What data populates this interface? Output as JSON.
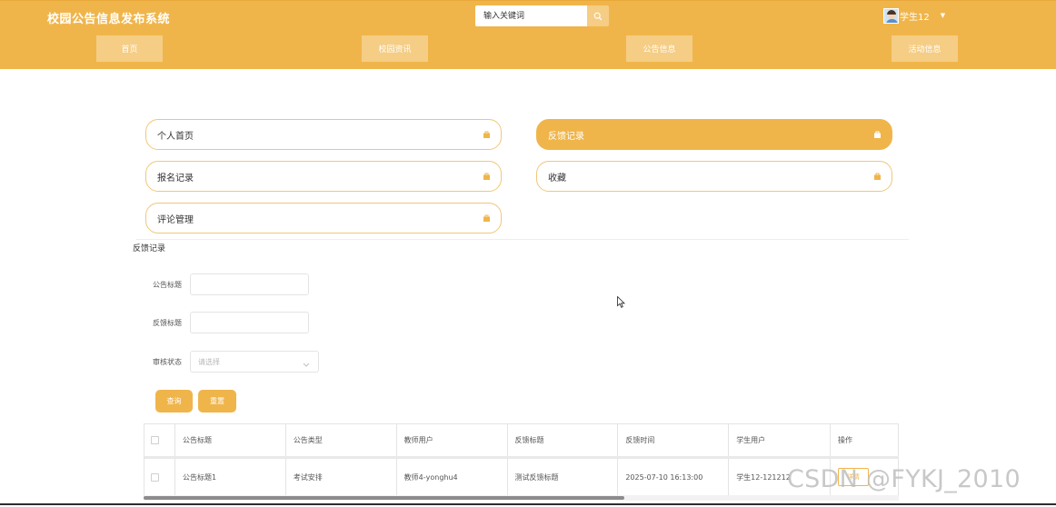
{
  "header": {
    "site_title": "校园公告信息发布系统",
    "search_placeholder": "输入关键词",
    "username": "学生12",
    "nav": [
      "首页",
      "校园资讯",
      "公告信息",
      "活动信息"
    ]
  },
  "menu": {
    "items": [
      "个人首页",
      "反馈记录",
      "报名记录",
      "收藏",
      "评论管理"
    ],
    "active": "反馈记录"
  },
  "section_title": "反馈记录",
  "form": {
    "title_label": "公告标题",
    "feedback_label": "反馈标题",
    "status_label": "审核状态",
    "status_placeholder": "请选择",
    "query_button": "查询",
    "reset_button": "重置"
  },
  "table": {
    "headers": [
      "公告标题",
      "公告类型",
      "教师用户",
      "反馈标题",
      "反馈时间",
      "学生用户",
      "操作"
    ],
    "rows": [
      [
        "公告标题1",
        "考试安排",
        "教师4-yonghu4",
        "测试反馈标题",
        "2025-07-10 16:13:00",
        "学生12-121212",
        "详情"
      ]
    ]
  },
  "watermark": "CSDN @FYKJ_2010",
  "colors": {
    "primary": "#f0b54a",
    "nav_button": "#f5cd85",
    "card_border": "#f0c77a"
  }
}
